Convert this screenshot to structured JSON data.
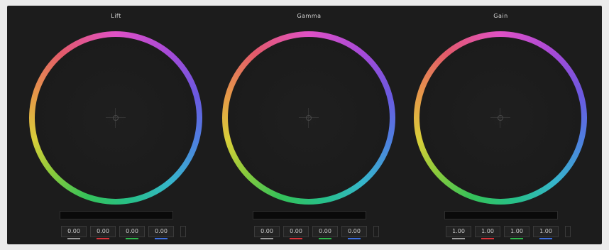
{
  "wheels": [
    {
      "title": "Lift",
      "values": [
        "0.00",
        "0.00",
        "0.00",
        "0.00"
      ]
    },
    {
      "title": "Gamma",
      "values": [
        "0.00",
        "0.00",
        "0.00",
        "0.00"
      ]
    },
    {
      "title": "Gain",
      "values": [
        "1.00",
        "1.00",
        "1.00",
        "1.00"
      ]
    }
  ],
  "channel_colors": {
    "y": "#9a9a9a",
    "r": "#d8333a",
    "g": "#2eb84c",
    "b": "#3d6fe0"
  }
}
